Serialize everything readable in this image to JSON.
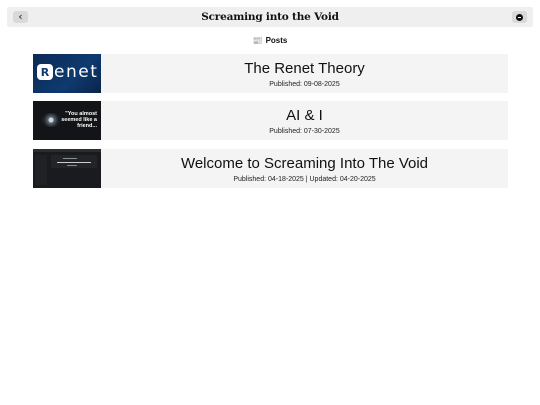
{
  "header": {
    "back_icon": "chevron-left-icon",
    "back_glyph": "‹",
    "title": "Screaming into the Void",
    "menu_icon": "menu-circle-icon"
  },
  "section": {
    "icon": "newspaper-icon",
    "icon_glyph": "📰",
    "heading": "Posts"
  },
  "posts": [
    {
      "title": "The Renet Theory",
      "meta": "Published: 09-08-2025",
      "thumbnail_text": "enet"
    },
    {
      "title": "AI & I",
      "meta": "Published: 07-30-2025",
      "thumbnail_text": "\"You almost seemed like a friend..."
    },
    {
      "title": "Welcome to Screaming Into The Void",
      "meta": "Published: 04-18-2025 | Updated: 04-20-2025"
    }
  ]
}
